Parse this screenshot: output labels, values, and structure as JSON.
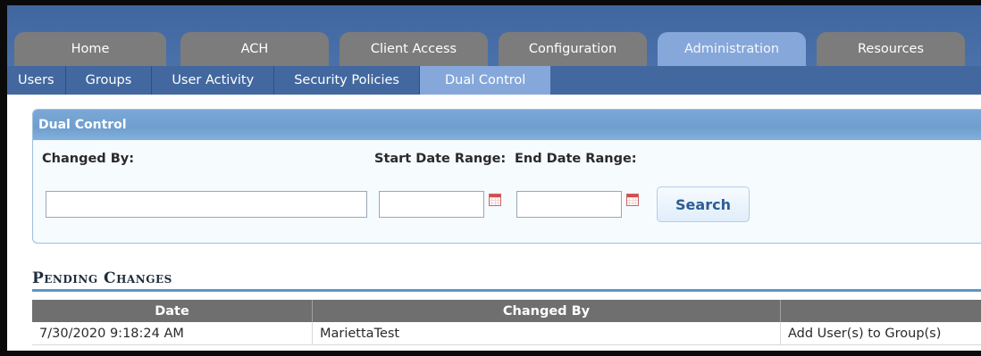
{
  "nav": {
    "tabs": [
      {
        "label": "Home"
      },
      {
        "label": "ACH"
      },
      {
        "label": "Client Access"
      },
      {
        "label": "Configuration"
      },
      {
        "label": "Administration",
        "active": true
      },
      {
        "label": "Resources"
      }
    ],
    "subitems": [
      {
        "label": "Users"
      },
      {
        "label": "Groups"
      },
      {
        "label": "User Activity"
      },
      {
        "label": "Security Policies"
      },
      {
        "label": "Dual Control",
        "active": true
      }
    ]
  },
  "panel": {
    "title": "Dual Control",
    "changed_by_label": "Changed By:",
    "changed_by_value": "",
    "start_date_label": "Start Date Range:",
    "start_date_value": "",
    "end_date_label": "End Date Range:",
    "end_date_value": "",
    "search_label": "Search"
  },
  "pending": {
    "title": "Pending Changes",
    "columns": [
      "Date",
      "Changed By",
      ""
    ],
    "rows": [
      {
        "date": "7/30/2020 9:18:24 AM",
        "changed_by": "MariettaTest",
        "change": "Add User(s) to Group(s)"
      }
    ]
  },
  "colors": {
    "header_blue": "#41669f",
    "active_tab": "#86a7d9",
    "inactive_tab": "#7c7c7c",
    "panel_header": "#7aa8d6",
    "table_header": "#6f6f6f"
  }
}
